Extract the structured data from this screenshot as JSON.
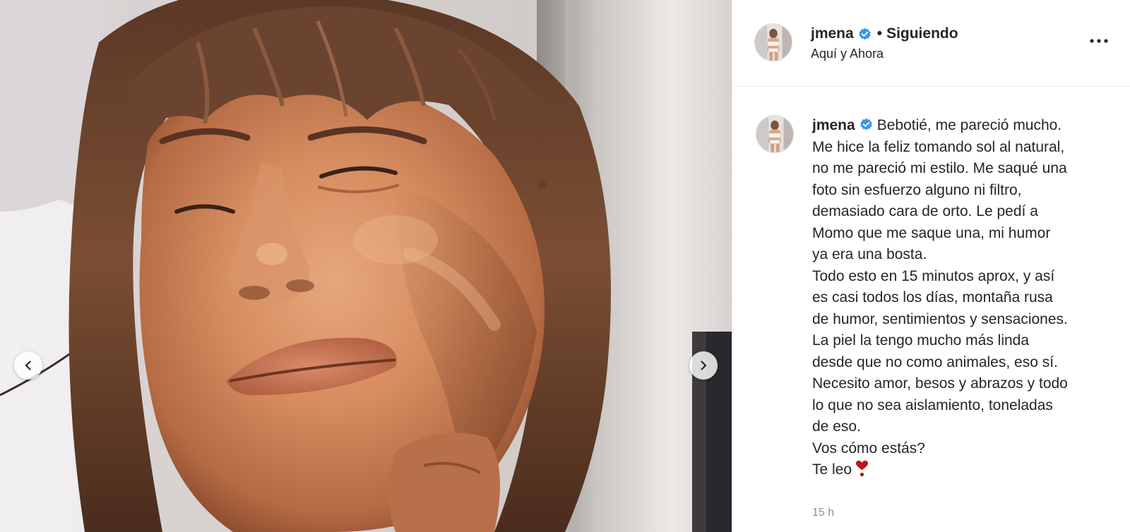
{
  "post": {
    "author": {
      "username": "jmena",
      "verified": true,
      "follow_status": "Siguiendo",
      "separator": "•",
      "location": "Aquí y Ahora"
    },
    "media": {
      "description_icon": "photo",
      "has_prev": true,
      "has_next": true
    },
    "caption": {
      "username": "jmena",
      "lines": [
        "Bebotié, me pareció mucho.",
        "Me hice la feliz tomando sol al natural,",
        "no me pareció mi estilo. Me saqué una",
        "foto sin esfuerzo alguno ni filtro,",
        "demasiado cara de orto. Le pedí a",
        "Momo que me saque una, mi humor",
        "ya era una bosta.",
        "Todo esto en 15 minutos aprox, y así",
        "es casi todos los días, montaña rusa",
        "de humor, sentimientos y sensaciones.",
        "La piel la tengo mucho más linda",
        "desde que no como animales, eso sí.",
        "Necesito amor, besos y abrazos y todo",
        "lo que no sea aislamiento, toneladas",
        "de eso.",
        "Vos cómo estás?",
        "Te leo"
      ],
      "emoji": "heart-exclamation-icon"
    },
    "timestamp": "15 h"
  },
  "colors": {
    "verified_blue": "#3897f0",
    "heart_red": "#c0141c",
    "text": "#262626",
    "muted": "#8e8e8e",
    "divider": "#efefef"
  }
}
